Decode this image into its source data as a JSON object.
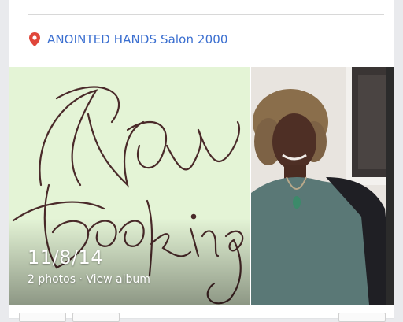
{
  "post": {
    "location": {
      "label": "ANOINTED HANDS Salon 2000",
      "icon": "map-pin-icon",
      "color": "#3b6fd0",
      "pin_color": "#e0463a"
    },
    "album": {
      "date": "11/8/14",
      "meta": "2 photos · View album",
      "photos": [
        {
          "description_name": "now-booking-image",
          "art_text": "Now Booking"
        },
        {
          "description_name": "portrait-photo"
        }
      ]
    }
  }
}
